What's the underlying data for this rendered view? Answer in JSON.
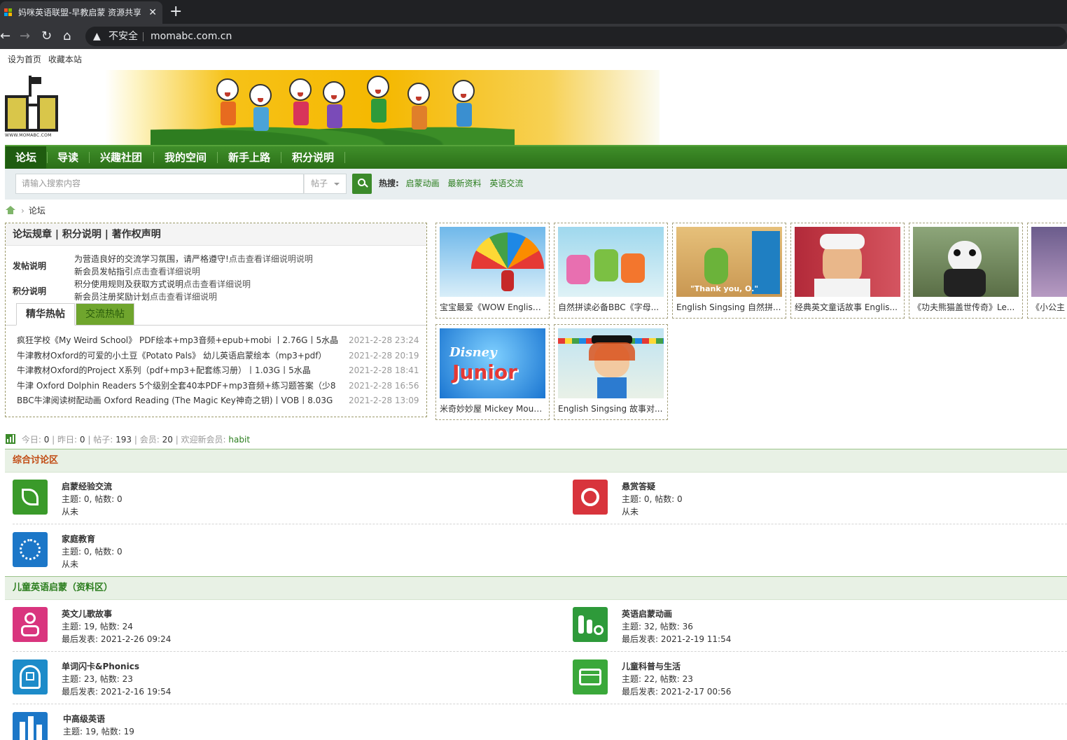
{
  "browser": {
    "tab_title": "妈咪英语联盟-早教启蒙 资源共享",
    "insecure_label": "不安全",
    "url": "momabc.com.cn"
  },
  "toplinks": [
    "设为首页",
    "收藏本站"
  ],
  "logo_text": "WWW.MOMABC.COM",
  "nav": [
    "论坛",
    "导读",
    "兴趣社团",
    "我的空间",
    "新手上路",
    "积分说明"
  ],
  "search": {
    "placeholder": "请输入搜索内容",
    "type": "帖子",
    "hot_label": "热搜:",
    "hot_links": [
      "启蒙动画",
      "最新资料",
      "英语交流"
    ]
  },
  "breadcrumb": {
    "current": "论坛"
  },
  "rules": {
    "title": "论坛规章 | 积分说明 | 著作权声明",
    "post_label": "发帖说明",
    "post_line1_text": "为营造良好的交流学习氛围，请严格遵守!",
    "post_line1_link": "点击查看详细说明说明",
    "post_line2_text": "新会员发帖指引",
    "post_line2_link": "点击查看详细说明",
    "points_label": "积分说明",
    "points_line1_text": "积分使用规则及获取方式说明",
    "points_line1_link": "点击查看详细说明",
    "points_line2_text": "新会员注册奖励计划",
    "points_line2_link": "点击查看详细说明",
    "tab_active": "精华热帖",
    "tab_inactive": "交流热帖",
    "threads": [
      {
        "title": "疯狂学校《My Weird School》 PDF绘本+mp3音频+epub+mobi 丨2.76G丨5水晶",
        "date": "2021-2-28 23:24"
      },
      {
        "title": "牛津教材Oxford的可爱的小土豆《Potato Pals》 幼儿英语启蒙绘本（mp3+pdf）",
        "date": "2021-2-28 20:19"
      },
      {
        "title": "牛津教材Oxford的Project X系列（pdf+mp3+配套练习册）丨1.03G丨5水晶",
        "date": "2021-2-28 18:41"
      },
      {
        "title": "牛津 Oxford Dolphin Readers 5个级别全套40本PDF+mp3音频+练习题答案（少8",
        "date": "2021-2-28 16:56"
      },
      {
        "title": "BBC牛津阅读树配动画 Oxford Reading (The Magic Key神奇之钥)丨VOB丨8.03G",
        "date": "2021-2-28 13:09"
      }
    ]
  },
  "gallery": [
    {
      "caption": "宝宝最爱《WOW English..."
    },
    {
      "caption": "自然拼读必备BBC《字母..."
    },
    {
      "caption": "English Singsing 自然拼...",
      "overlay": "\"Thank you, O.\""
    },
    {
      "caption": "经典英文童话故事 Englis..."
    },
    {
      "caption": "《功夫熊猫盖世传奇》Le..."
    },
    {
      "caption": "《小公主"
    },
    {
      "caption": "米奇妙妙屋 Mickey Mous...",
      "logo_top": "Disney",
      "logo_bottom": "Junior"
    },
    {
      "caption": "English Singsing 故事对..."
    }
  ],
  "stats": {
    "today_label": "今日:",
    "today": "0",
    "yesterday_label": "昨日:",
    "yesterday": "0",
    "posts_label": "帖子:",
    "posts": "193",
    "members_label": "会员:",
    "members": "20",
    "welcome_label": "欢迎新会员:",
    "newest": "habit"
  },
  "sections": [
    {
      "title": "综合讨论区",
      "forums": [
        {
          "name": "启蒙经验交流",
          "stat": "主题: 0, 帖数: 0",
          "last": "从未",
          "color": "#3a9a2a"
        },
        {
          "name": "悬赏答疑",
          "stat": "主题: 0, 帖数: 0",
          "last": "从未",
          "color": "#d8343c"
        },
        {
          "name": "家庭教育",
          "stat": "主题: 0, 帖数: 0",
          "last": "从未",
          "color": "#1c77c8"
        }
      ]
    },
    {
      "title": "儿童英语启蒙（资料区）",
      "forums": [
        {
          "name": "英文儿歌故事",
          "stat": "主题: 19, 帖数: 24",
          "last": "最后发表: 2021-2-26 09:24",
          "color": "#d9357e"
        },
        {
          "name": "英语启蒙动画",
          "stat": "主题: 32, 帖数: 36",
          "last": "最后发表: 2021-2-19 11:54",
          "color": "#2e9a3a"
        },
        {
          "name": "单词闪卡&Phonics",
          "stat": "主题: 23, 帖数: 23",
          "last": "最后发表: 2021-2-16 19:54",
          "color": "#1d8bc9"
        },
        {
          "name": "儿童科普与生活",
          "stat": "主题: 22, 帖数: 23",
          "last": "最后发表: 2021-2-17 00:56",
          "color": "#3aa83a"
        },
        {
          "name": "中高级英语",
          "stat": "主题: 19, 帖数: 19",
          "last": "",
          "color": "#1c77c8"
        }
      ]
    }
  ]
}
